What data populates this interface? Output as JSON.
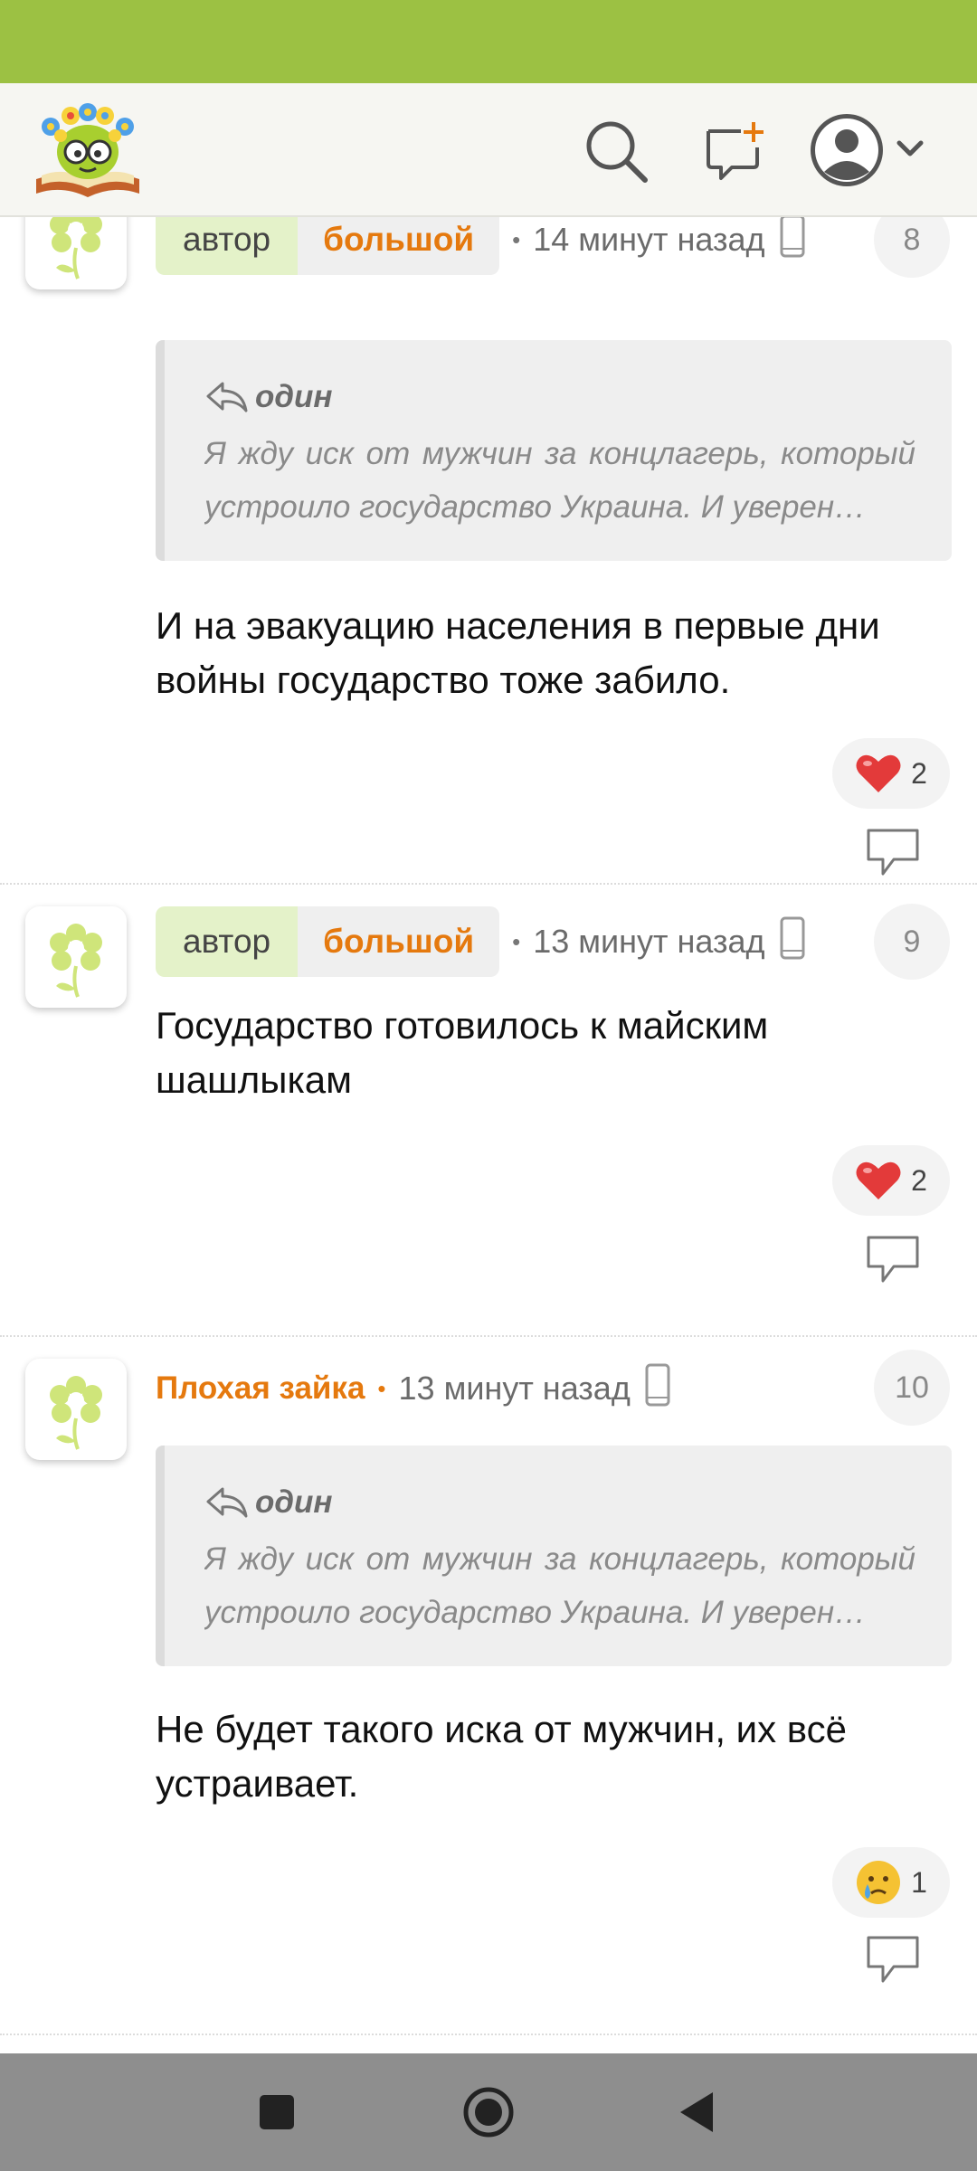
{
  "colors": {
    "status_bar": "#9cc143",
    "accent_orange": "#e5790e",
    "author_tag_bg": "#e4f2c9"
  },
  "header": {
    "icons": [
      "logo-icon",
      "search-icon",
      "new-message-icon",
      "user-avatar-icon",
      "chevron-down-icon"
    ]
  },
  "comments": [
    {
      "author_tag": "автор",
      "username": "большой",
      "time": "14 минут назад",
      "number": "8",
      "quote": {
        "author": "один",
        "text": "Я жду иск от мужчин за концлагерь, который устроило государство Украина. И уверен…"
      },
      "text": "И на эвакуацию населения в первые дни войны государство тоже забило.",
      "reaction": {
        "emoji": "heart",
        "count": "2"
      }
    },
    {
      "author_tag": "автор",
      "username": "большой",
      "time": "13 минут назад",
      "number": "9",
      "text": "Государство готовилось к майским шашлыкам",
      "reaction": {
        "emoji": "heart",
        "count": "2"
      }
    },
    {
      "username": "Плохая зайка",
      "time": "13 минут назад",
      "number": "10",
      "quote": {
        "author": "один",
        "text": "Я жду иск от мужчин за концлагерь, который устроило государство Украина. И уверен…"
      },
      "text": "Не будет такого иска от мужчин, их всё устраивает.",
      "reaction": {
        "emoji": "crying-face",
        "count": "1"
      }
    }
  ],
  "navbar": {
    "icons": [
      "recent-apps-icon",
      "home-icon",
      "back-icon"
    ]
  }
}
